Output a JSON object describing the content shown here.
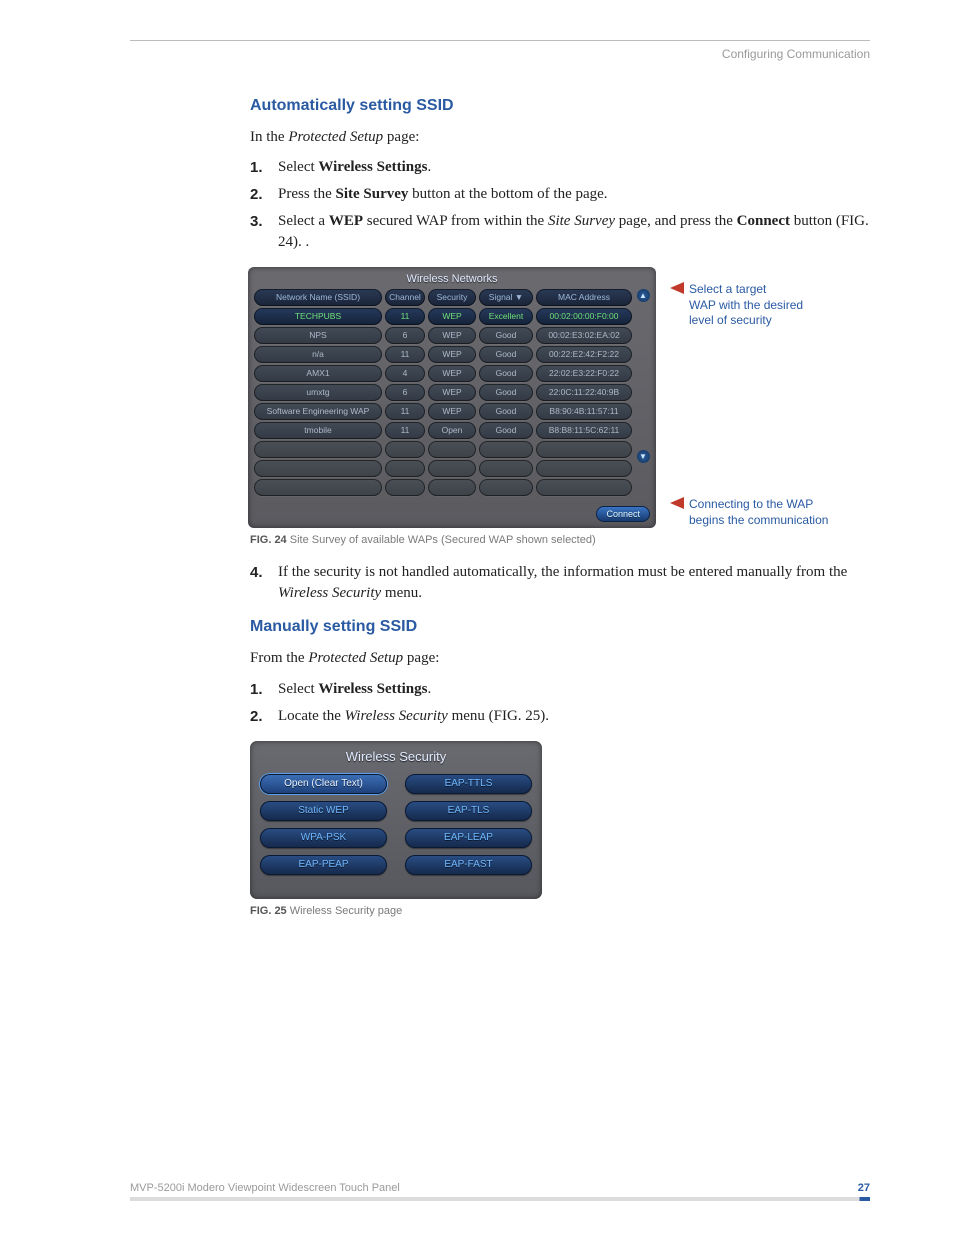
{
  "header": {
    "chapter": "Configuring Communication"
  },
  "sec1": {
    "heading": "Automatically setting SSID",
    "intro_pre": "In the ",
    "intro_em": "Protected Setup",
    "intro_post": " page:",
    "steps": [
      {
        "n": "1.",
        "pre": "Select ",
        "b": "Wireless Settings",
        "post": "."
      },
      {
        "n": "2.",
        "pre": "Press the ",
        "b": "Site Survey",
        "post": " button at the bottom of the page."
      },
      {
        "n": "3.",
        "pre": "Select a ",
        "b": "WEP",
        "mid": " secured WAP from within the ",
        "em": "Site Survey",
        "mid2": " page, and press the ",
        "b2": "Connect",
        "post": " button (FIG. 24). ."
      }
    ]
  },
  "fig24": {
    "title": "Wireless Networks",
    "headers": {
      "c1": "Network Name (SSID)",
      "c2": "Channel",
      "c3": "Security",
      "c4": "Signal ▼",
      "c5": "MAC Address"
    },
    "rows": [
      {
        "c1": "TECHPUBS",
        "c2": "11",
        "c3": "WEP",
        "c4": "Excellent",
        "c5": "00:02:00:00:F0:00",
        "sel": true
      },
      {
        "c1": "NPS",
        "c2": "6",
        "c3": "WEP",
        "c4": "Good",
        "c5": "00:02:E3:02:EA:02"
      },
      {
        "c1": "n/a",
        "c2": "11",
        "c3": "WEP",
        "c4": "Good",
        "c5": "00:22:E2:42:F2:22"
      },
      {
        "c1": "AMX1",
        "c2": "4",
        "c3": "WEP",
        "c4": "Good",
        "c5": "22:02:E3:22:F0:22"
      },
      {
        "c1": "umxtg",
        "c2": "6",
        "c3": "WEP",
        "c4": "Good",
        "c5": "22:0C:11:22:40:9B"
      },
      {
        "c1": "Software Engineering WAP",
        "c2": "11",
        "c3": "WEP",
        "c4": "Good",
        "c5": "B8:90:4B:11:57:11"
      },
      {
        "c1": "tmobile",
        "c2": "11",
        "c3": "Open",
        "c4": "Good",
        "c5": "B8:B8:11:5C:62:11"
      }
    ],
    "connect": "Connect",
    "callout1_l1": "Select a target",
    "callout1_l2": "WAP with the desired",
    "callout1_l3": "level of security",
    "callout2_l1": "Connecting to the WAP",
    "callout2_l2": "begins the communication",
    "cap_b": "FIG. 24",
    "cap_t": "  Site Survey of available WAPs (Secured WAP shown selected)"
  },
  "step4": {
    "n": "4.",
    "pre": "If the security is not handled automatically, the information must be entered manually from the ",
    "em": "Wireless Security",
    "post": " menu."
  },
  "sec2": {
    "heading": "Manually setting SSID",
    "intro_pre": "From the ",
    "intro_em": "Protected Setup",
    "intro_post": " page:",
    "steps": [
      {
        "n": "1.",
        "pre": "Select ",
        "b": "Wireless Settings",
        "post": "."
      },
      {
        "n": "2.",
        "pre": "Locate the ",
        "em": "Wireless Security",
        "post": " menu (FIG. 25)."
      }
    ]
  },
  "fig25": {
    "title": "Wireless Security",
    "buttons": [
      {
        "label": "Open (Clear Text)",
        "sel": true
      },
      {
        "label": "EAP-TTLS"
      },
      {
        "label": "Static WEP"
      },
      {
        "label": "EAP-TLS"
      },
      {
        "label": "WPA-PSK"
      },
      {
        "label": "EAP-LEAP"
      },
      {
        "label": "EAP-PEAP"
      },
      {
        "label": "EAP-FAST"
      }
    ],
    "cap_b": "FIG. 25",
    "cap_t": "  Wireless Security page"
  },
  "footer": {
    "product": "MVP-5200i Modero Viewpoint Widescreen Touch Panel",
    "page": "27"
  }
}
